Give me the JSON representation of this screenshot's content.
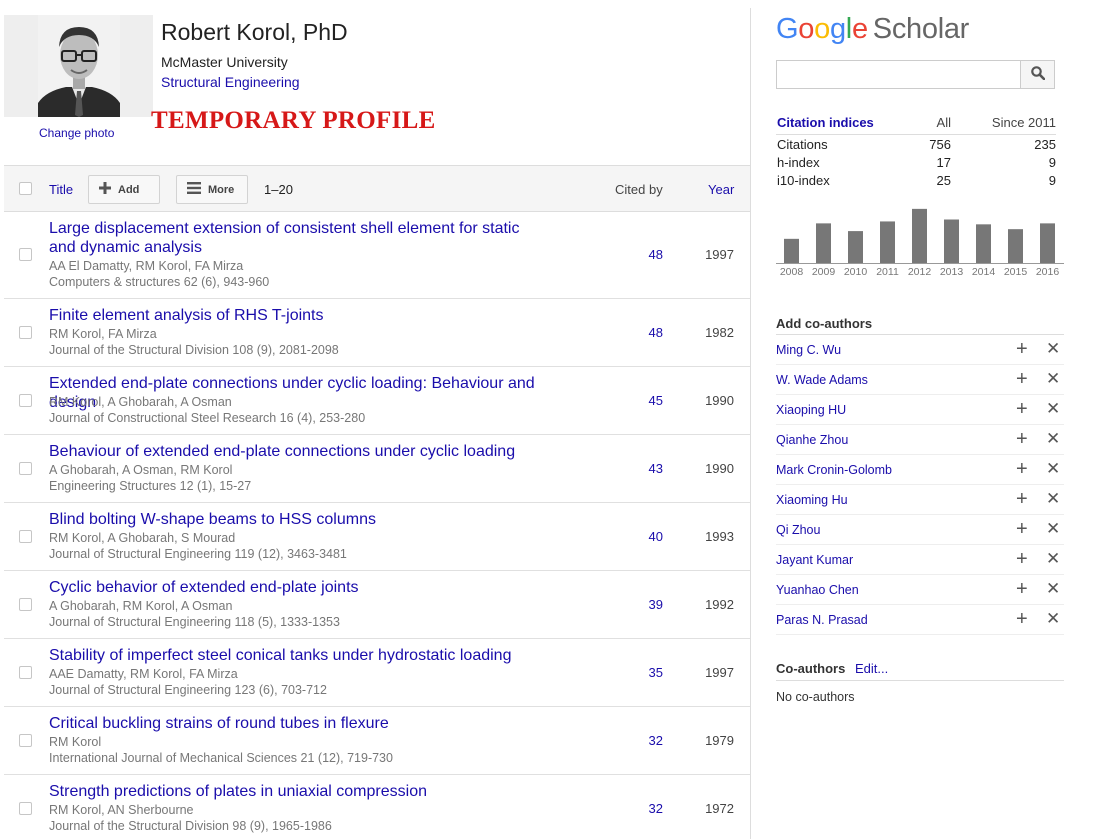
{
  "profile": {
    "name": "Robert Korol, PhD",
    "affiliation": "McMaster University",
    "interest": "Structural Engineering",
    "change_photo": "Change photo",
    "temporary_label": "TEMPORARY PROFILE"
  },
  "table_header": {
    "title": "Title",
    "add": "Add",
    "more": "More",
    "range": "1–20",
    "cited_by": "Cited by",
    "year": "Year"
  },
  "publications": [
    {
      "title": "Large displacement extension of consistent shell element for static and dynamic analysis",
      "authors": "AA El Damatty, RM Korol, FA Mirza",
      "venue": "Computers & structures 62 (6), 943-960",
      "cited_by": "48",
      "year": "1997"
    },
    {
      "title": "Finite element analysis of RHS T-joints",
      "authors": "RM Korol, FA Mirza",
      "venue": "Journal of the Structural Division 108 (9), 2081-2098",
      "cited_by": "48",
      "year": "1982"
    },
    {
      "title": "Extended end-plate connections under cyclic loading: Behaviour and design",
      "authors": "RM Korol, A Ghobarah, A Osman",
      "venue": "Journal of Constructional Steel Research 16 (4), 253-280",
      "cited_by": "45",
      "year": "1990"
    },
    {
      "title": "Behaviour of extended end-plate connections under cyclic loading",
      "authors": "A Ghobarah, A Osman, RM Korol",
      "venue": "Engineering Structures 12 (1), 15-27",
      "cited_by": "43",
      "year": "1990"
    },
    {
      "title": "Blind bolting W-shape beams to HSS columns",
      "authors": "RM Korol, A Ghobarah, S Mourad",
      "venue": "Journal of Structural Engineering 119 (12), 3463-3481",
      "cited_by": "40",
      "year": "1993"
    },
    {
      "title": "Cyclic behavior of extended end-plate joints",
      "authors": "A Ghobarah, RM Korol, A Osman",
      "venue": "Journal of Structural Engineering 118 (5), 1333-1353",
      "cited_by": "39",
      "year": "1992"
    },
    {
      "title": "Stability of imperfect steel conical tanks under hydrostatic loading",
      "authors": "AAE Damatty, RM Korol, FA Mirza",
      "venue": "Journal of Structural Engineering 123 (6), 703-712",
      "cited_by": "35",
      "year": "1997"
    },
    {
      "title": "Critical buckling strains of round tubes in flexure",
      "authors": "RM Korol",
      "venue": "International Journal of Mechanical Sciences 21 (12), 719-730",
      "cited_by": "32",
      "year": "1979"
    },
    {
      "title": "Strength predictions of plates in uniaxial compression",
      "authors": "RM Korol, AN Sherbourne",
      "venue": "Journal of the Structural Division 98 (9), 1965-1986",
      "cited_by": "32",
      "year": "1972"
    }
  ],
  "logo": {
    "g1": "G",
    "g2": "o",
    "g3": "o",
    "g4": "g",
    "g5": "l",
    "g6": "e",
    "scholar": "Scholar"
  },
  "search": {
    "placeholder": ""
  },
  "citation_indices": {
    "header": {
      "label": "Citation indices",
      "all": "All",
      "since": "Since 2011"
    },
    "rows": [
      {
        "label": "Citations",
        "all": "756",
        "since": "235"
      },
      {
        "label": "h-index",
        "all": "17",
        "since": "9"
      },
      {
        "label": "i10-index",
        "all": "25",
        "since": "9"
      }
    ]
  },
  "chart_data": {
    "type": "bar",
    "categories": [
      "2008",
      "2009",
      "2010",
      "2011",
      "2012",
      "2013",
      "2014",
      "2015",
      "2016"
    ],
    "values": [
      25,
      41,
      33,
      43,
      56,
      45,
      40,
      35,
      41
    ],
    "ylim": [
      0,
      60
    ],
    "color": "#777777"
  },
  "add_coauthors": {
    "title": "Add co-authors",
    "names": [
      "Ming C. Wu",
      "W. Wade Adams",
      "Xiaoping HU",
      "Qianhe Zhou",
      "Mark Cronin-Golomb",
      "Xiaoming Hu",
      "Qi Zhou",
      "Jayant Kumar",
      "Yuanhao Chen",
      "Paras N. Prasad"
    ],
    "plus_glyph": "+",
    "x_glyph": "✕"
  },
  "coauthors": {
    "title": "Co-authors",
    "edit": "Edit...",
    "empty": "No co-authors"
  }
}
